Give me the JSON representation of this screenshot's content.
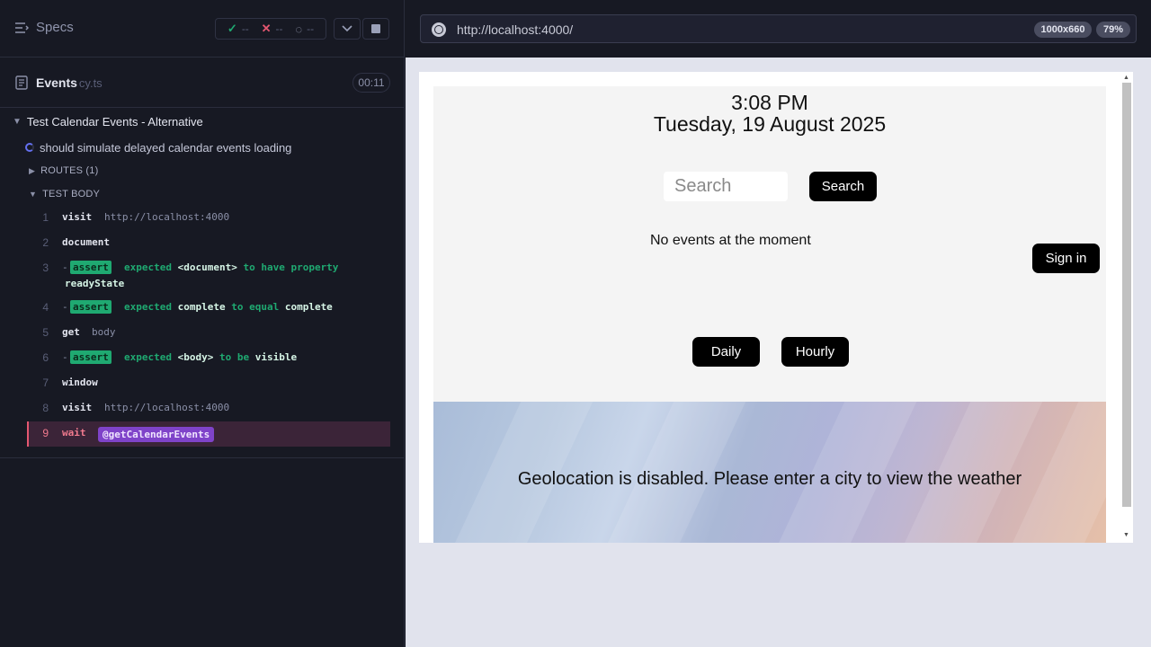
{
  "reporter": {
    "specs_label": "Specs",
    "stats": {
      "passed": "--",
      "failed": "--",
      "pending": "--"
    },
    "file": {
      "name": "Events",
      "ext": "cy.ts",
      "duration": "00:11"
    },
    "suite_title": "Test Calendar Events - Alternative",
    "test_title": "should simulate delayed calendar events loading",
    "routes_label": "ROUTES (1)",
    "test_body_label": "TEST BODY",
    "commands": [
      {
        "num": "1",
        "name": "visit",
        "message": "http://localhost:4000"
      },
      {
        "num": "2",
        "name": "document",
        "message": ""
      },
      {
        "num": "3",
        "name": "-",
        "badge": "assert",
        "line1_pre": "expected",
        "line1_hl": "<document>",
        "line1_post": "to have property",
        "line2": "readyState"
      },
      {
        "num": "4",
        "name": "-",
        "badge": "assert",
        "pre": "expected",
        "hl1": "complete",
        "mid": "to equal",
        "hl2": "complete"
      },
      {
        "num": "5",
        "name": "get",
        "message": "body"
      },
      {
        "num": "6",
        "name": "-",
        "badge": "assert",
        "pre": "expected",
        "hl1": "<body>",
        "mid": "to be",
        "hl2": "visible"
      },
      {
        "num": "7",
        "name": "window",
        "message": ""
      },
      {
        "num": "8",
        "name": "visit",
        "message": "http://localhost:4000"
      },
      {
        "num": "9",
        "name": "wait",
        "alias": "@getCalendarEvents"
      }
    ]
  },
  "browser": {
    "url": "http://localhost:4000/",
    "viewport": "1000x660",
    "zoom": "79%"
  },
  "app": {
    "time": "3:08 PM",
    "date": "Tuesday, 19 August 2025",
    "search_placeholder": "Search",
    "search_button": "Search",
    "no_events": "No events at the moment",
    "sign_in": "Sign in",
    "daily": "Daily",
    "hourly": "Hourly",
    "weather_message": "Geolocation is disabled. Please enter a city to view the weather"
  },
  "colors": {
    "pass": "#1fa971",
    "fail": "#e45770",
    "alias": "#7f43c9",
    "active_row": "#3b2438"
  },
  "icons": [
    "specs-list-icon",
    "check-icon",
    "x-icon",
    "spinner-icon",
    "chevron-down-icon",
    "stop-icon",
    "file-icon",
    "globe-icon"
  ]
}
